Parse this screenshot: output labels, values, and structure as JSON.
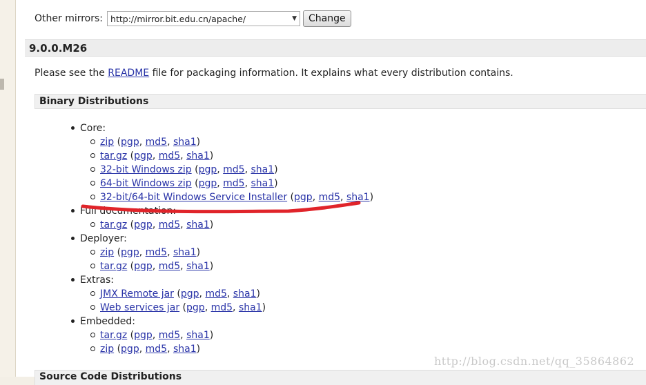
{
  "mirror": {
    "label": "Other mirrors:",
    "selected": "http://mirror.bit.edu.cn/apache/",
    "button": "Change"
  },
  "version": {
    "title": "9.0.0.M26"
  },
  "intro": {
    "before": "Please see the ",
    "link": "README",
    "after": " file for packaging information. It explains what every distribution contains."
  },
  "binary": {
    "title": "Binary Distributions",
    "groups": [
      {
        "label": "Core:",
        "items": [
          {
            "name": "zip",
            "sigs": [
              "pgp",
              "md5",
              "sha1"
            ]
          },
          {
            "name": "tar.gz",
            "sigs": [
              "pgp",
              "md5",
              "sha1"
            ]
          },
          {
            "name": "32-bit Windows zip",
            "sigs": [
              "pgp",
              "md5",
              "sha1"
            ]
          },
          {
            "name": "64-bit Windows zip",
            "sigs": [
              "pgp",
              "md5",
              "sha1"
            ]
          },
          {
            "name": "32-bit/64-bit Windows Service Installer",
            "sigs": [
              "pgp",
              "md5",
              "sha1"
            ]
          }
        ]
      },
      {
        "label": "Full documentation:",
        "items": [
          {
            "name": "tar.gz",
            "sigs": [
              "pgp",
              "md5",
              "sha1"
            ]
          }
        ]
      },
      {
        "label": "Deployer:",
        "items": [
          {
            "name": "zip",
            "sigs": [
              "pgp",
              "md5",
              "sha1"
            ]
          },
          {
            "name": "tar.gz",
            "sigs": [
              "pgp",
              "md5",
              "sha1"
            ]
          }
        ]
      },
      {
        "label": "Extras:",
        "items": [
          {
            "name": "JMX Remote jar",
            "sigs": [
              "pgp",
              "md5",
              "sha1"
            ]
          },
          {
            "name": "Web services jar",
            "sigs": [
              "pgp",
              "md5",
              "sha1"
            ]
          }
        ]
      },
      {
        "label": "Embedded:",
        "items": [
          {
            "name": "tar.gz",
            "sigs": [
              "pgp",
              "md5",
              "sha1"
            ]
          },
          {
            "name": "zip",
            "sigs": [
              "pgp",
              "md5",
              "sha1"
            ]
          }
        ]
      }
    ]
  },
  "source": {
    "title": "Source Code Distributions"
  },
  "watermark": "http://blog.csdn.net/qq_35864862",
  "colors": {
    "link": "#2a34a8",
    "annotation": "#e0242a",
    "header_bg": "#ededed"
  }
}
